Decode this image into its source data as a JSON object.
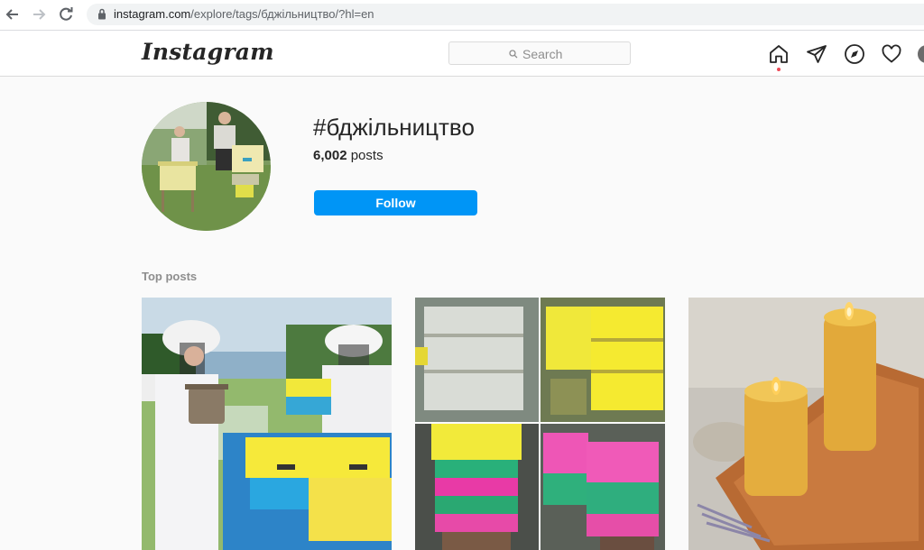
{
  "browser": {
    "url_domain": "instagram.com",
    "url_path": "/explore/tags/бджільництво/?hl=en"
  },
  "header": {
    "logo": "Instagram",
    "search_placeholder": "Search"
  },
  "tag": {
    "title": "#бджільництво",
    "posts_count": "6,002",
    "posts_label": "posts",
    "follow_label": "Follow"
  },
  "sections": {
    "top_posts_label": "Top posts"
  },
  "colors": {
    "accent": "#0095f6",
    "notification": "#ed4956"
  }
}
